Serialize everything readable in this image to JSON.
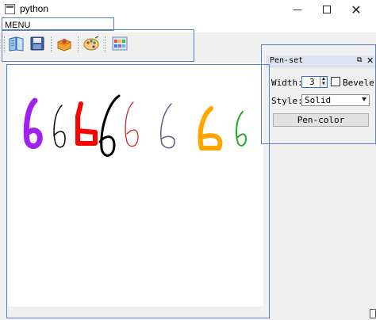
{
  "window": {
    "title": "python",
    "controls": {
      "minimize": "—",
      "maximize": "",
      "close": "✕"
    }
  },
  "menubar": {
    "label": "MENU"
  },
  "toolbar": {
    "buttons": [
      {
        "name": "open-book-icon"
      },
      {
        "name": "save-disk-icon"
      },
      {
        "name": "clear-box-icon"
      },
      {
        "name": "palette-icon"
      },
      {
        "name": "color-grid-icon"
      }
    ]
  },
  "canvas": {
    "strokes": [
      {
        "glyph": "6",
        "color": "#a020f0"
      },
      {
        "glyph": "6",
        "color": "#000000"
      },
      {
        "glyph": "6",
        "color": "#ff0000"
      },
      {
        "glyph": "6",
        "color": "#000000"
      },
      {
        "glyph": "6",
        "color": "#cc2a2a"
      },
      {
        "glyph": "6",
        "color": "#5c5c8a"
      },
      {
        "glyph": "6",
        "color": "#ffa500"
      },
      {
        "glyph": "6",
        "color": "#22aa22"
      }
    ]
  },
  "dock": {
    "title": "Pen-set",
    "float_icon": "⧉",
    "close_icon": "✕",
    "width_label": "Width:",
    "width_value": "3",
    "bevel_label": "Bevele",
    "bevel_checked": false,
    "style_label": "Style:",
    "style_value": "Solid",
    "pen_color_button": "Pen-color"
  },
  "colors": {
    "annotation": "#5b7fc2",
    "accent": "#3a6fc0"
  }
}
